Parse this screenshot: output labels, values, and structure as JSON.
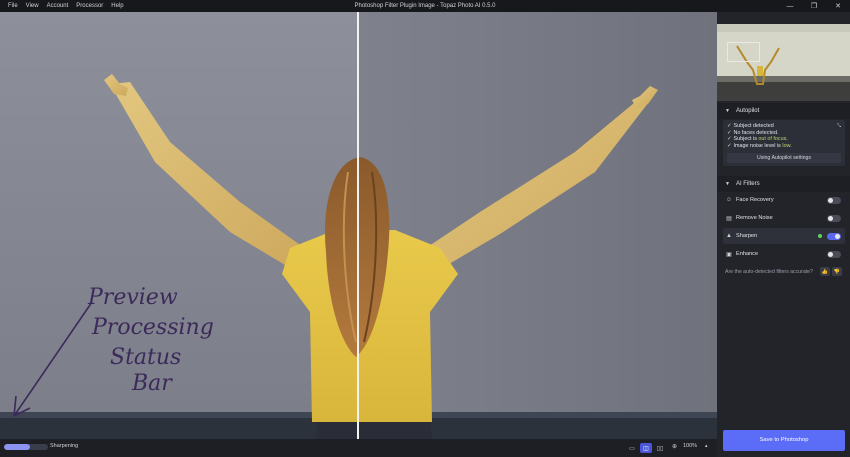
{
  "menu": [
    "File",
    "View",
    "Account",
    "Processor",
    "Help"
  ],
  "window": {
    "title": "Photoshop Filter Plugin Image - Topaz Photo AI 0.5.0",
    "minimize_glyph": "—",
    "restore_glyph": "❐",
    "close_glyph": "✕"
  },
  "preview": {
    "annotation_lines": [
      "Preview",
      "Processing",
      "Status",
      "Bar"
    ]
  },
  "status_bar": {
    "progress": 0.6,
    "status_text": "Sharpening",
    "zoom_label": "100%",
    "zoom_caret": "▴"
  },
  "autopilot": {
    "title": "Autopilot",
    "check": "✓",
    "line1": "Subject detected",
    "line2": "No faces detected.",
    "line3_prefix": "Subject is ",
    "line3_hl": "out of focus",
    "line3_suffix": ".",
    "line4_prefix": "Image noise level is ",
    "line4_hl": "low",
    "line4_suffix": ".",
    "settings_label": "Using Autopilot settings"
  },
  "filters": {
    "title": "AI Filters",
    "face_recovery": "Face Recovery",
    "remove_noise": "Remove Noise",
    "sharpen": "Sharpen",
    "enhance": "Enhance",
    "states": {
      "face_recovery": false,
      "remove_noise": false,
      "sharpen": true,
      "enhance": false
    }
  },
  "feedback": {
    "question": "Are the auto-detected filters accurate?"
  },
  "save_label": "Save to Photoshop",
  "icons": {
    "chevron": "chevron-down-icon",
    "face": "face-icon",
    "noise": "noise-icon",
    "sharpen": "sharpen-icon",
    "enhance": "enhance-icon",
    "thumbs_up": "thumbs-up-icon",
    "thumbs_down": "thumbs-down-icon"
  },
  "colors": {
    "accent": "#5b6cf7",
    "highlight": "#b6d76a",
    "status_dot": "#5fd35f"
  }
}
